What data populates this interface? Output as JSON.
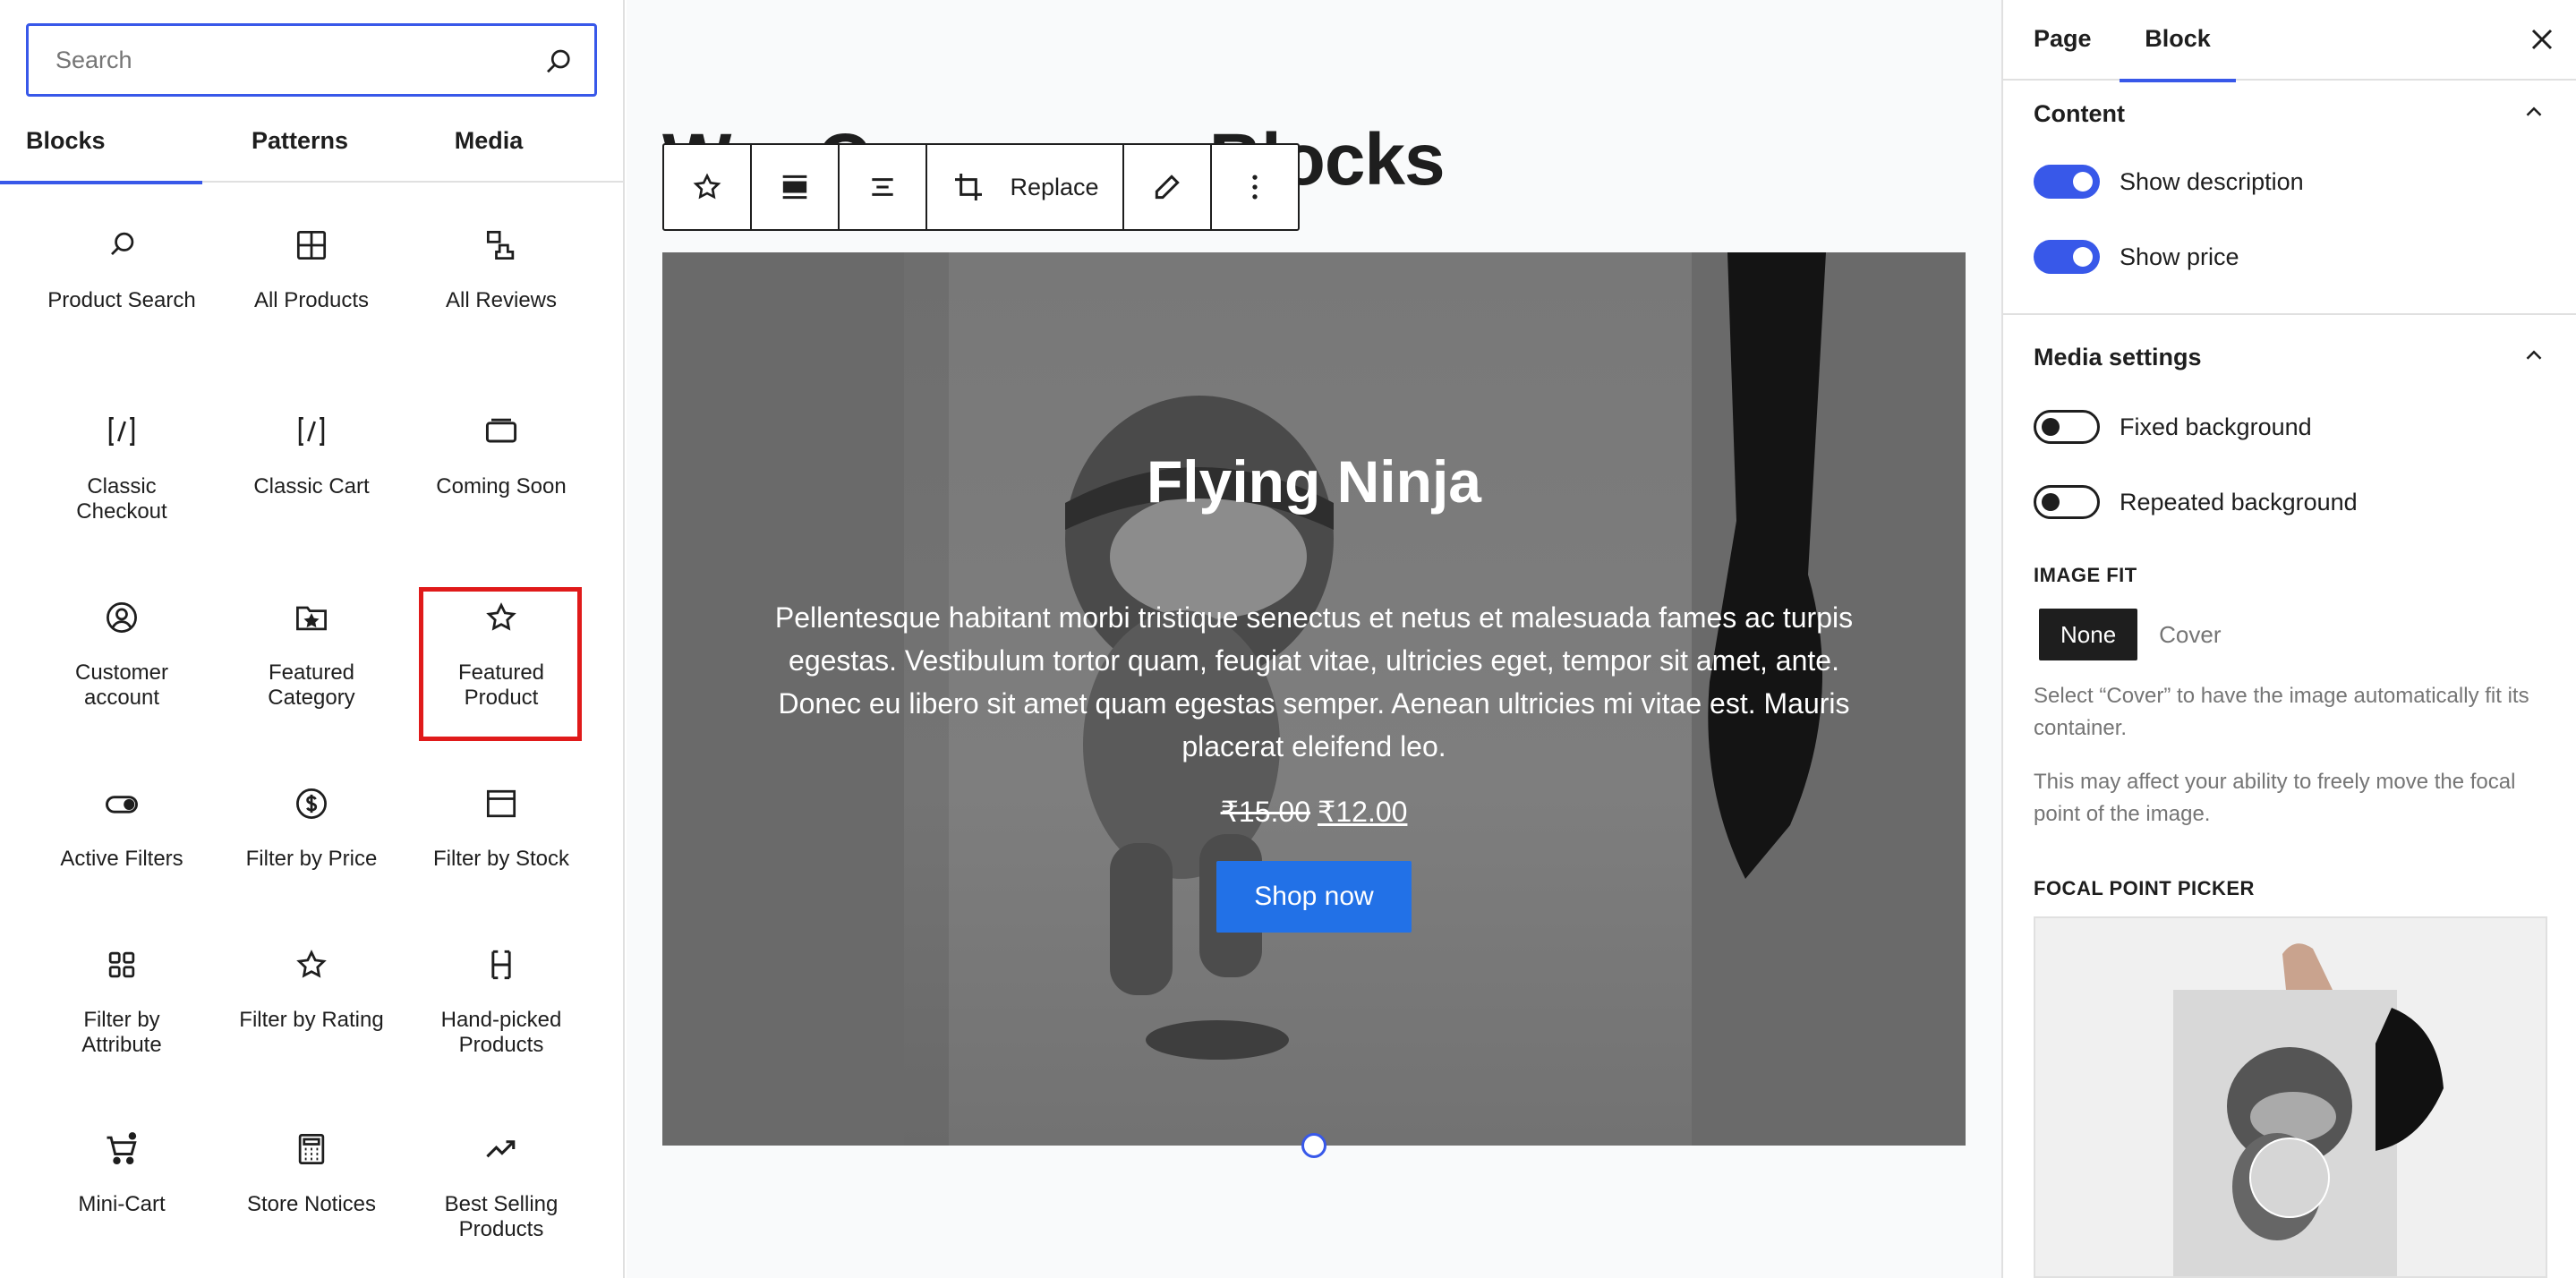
{
  "inserter": {
    "search_placeholder": "Search",
    "tabs": [
      "Blocks",
      "Patterns",
      "Media"
    ],
    "blocks": [
      {
        "label": "Product Search",
        "icon": "search-icon"
      },
      {
        "label": "All Products",
        "icon": "grid-icon"
      },
      {
        "label": "All Reviews",
        "icon": "reviews-icon"
      },
      {
        "label": "Classic Checkout",
        "icon": "shortcode-icon"
      },
      {
        "label": "Classic Cart",
        "icon": "shortcode-icon"
      },
      {
        "label": "Coming Soon",
        "icon": "card-icon"
      },
      {
        "label": "Customer account",
        "icon": "user-circle-icon"
      },
      {
        "label": "Featured Category",
        "icon": "folder-star-icon"
      },
      {
        "label": "Featured Product",
        "icon": "star-icon"
      },
      {
        "label": "Active Filters",
        "icon": "toggle-icon"
      },
      {
        "label": "Filter by Price",
        "icon": "dollar-circle-icon"
      },
      {
        "label": "Filter by Stock",
        "icon": "box-icon"
      },
      {
        "label": "Filter by Attribute",
        "icon": "grid-dots-icon"
      },
      {
        "label": "Filter by Rating",
        "icon": "star-icon"
      },
      {
        "label": "Hand-picked Products",
        "icon": "bracket-icon"
      },
      {
        "label": "Mini-Cart",
        "icon": "cart-icon"
      },
      {
        "label": "Store Notices",
        "icon": "calculator-icon"
      },
      {
        "label": "Best Selling Products",
        "icon": "trending-icon"
      }
    ]
  },
  "canvas": {
    "heading": "WooCommerce Blocks",
    "toolbar": {
      "replace_label": "Replace"
    },
    "hero": {
      "title": "Flying Ninja",
      "description": "Pellentesque habitant morbi tristique senectus et netus et malesuada fames ac turpis egestas. Vestibulum tortor quam, feugiat vitae, ultricies eget, tempor sit amet, ante. Donec eu libero sit amet quam egestas semper. Aenean ultricies mi vitae est. Mauris placerat eleifend leo.",
      "price_old": "₹15.00",
      "price_new": "₹12.00",
      "button": "Shop now"
    }
  },
  "settings": {
    "tabs": [
      "Page",
      "Block"
    ],
    "content_title": "Content",
    "show_description": {
      "label": "Show description",
      "on": true
    },
    "show_price": {
      "label": "Show price",
      "on": true
    },
    "media_title": "Media settings",
    "fixed_background": {
      "label": "Fixed background",
      "on": false
    },
    "repeated_background": {
      "label": "Repeated background",
      "on": false
    },
    "image_fit_label": "IMAGE FIT",
    "image_fit_options": [
      "None",
      "Cover"
    ],
    "image_fit_selected": "None",
    "help_1": "Select “Cover” to have the image automatically fit its container.",
    "help_2": "This may affect your ability to freely move the focal point of the image.",
    "focal_label": "FOCAL POINT PICKER"
  },
  "colors": {
    "accent": "#3858e9",
    "button_blue": "#2271e7",
    "highlight_red": "#e01a1a"
  }
}
